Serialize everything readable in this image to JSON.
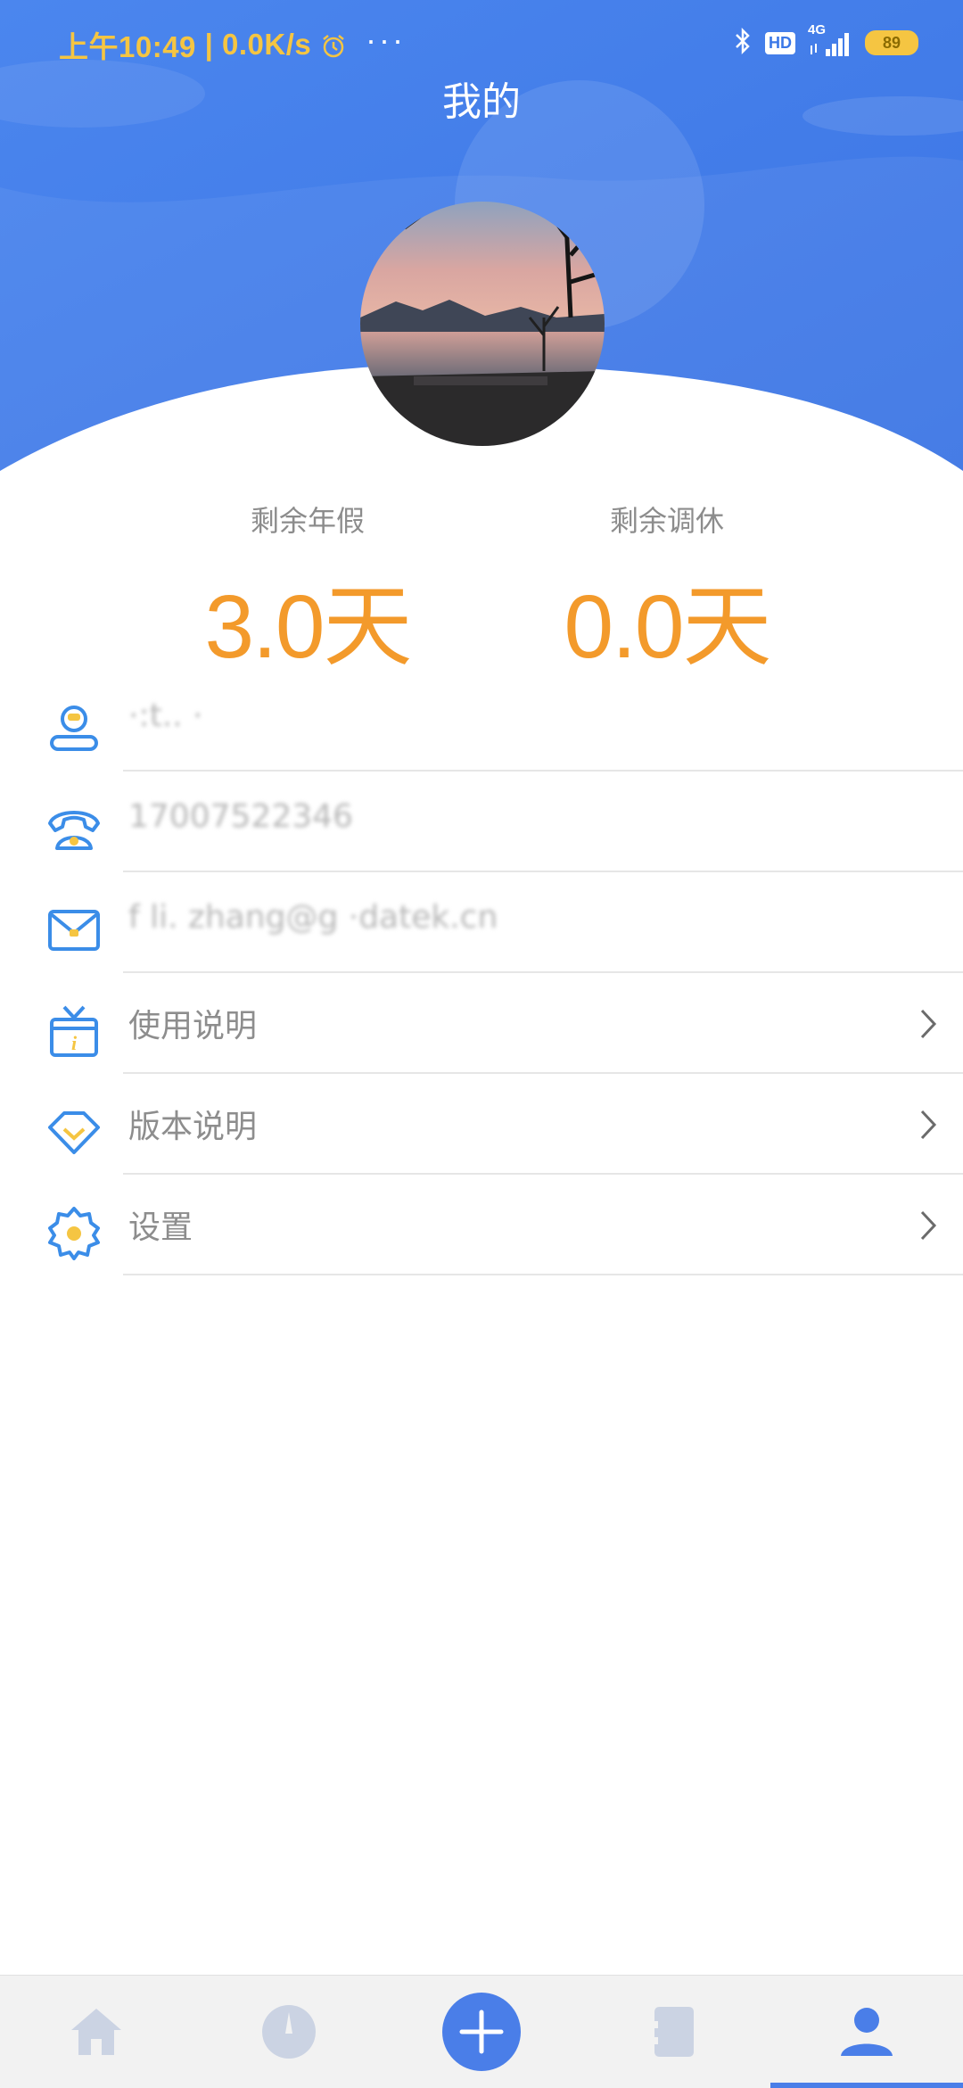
{
  "status_bar": {
    "time": "上午10:49",
    "speed": "0.0K/s",
    "more": "···",
    "hd_badge": "HD",
    "network": "4G",
    "battery": "89"
  },
  "header": {
    "title": "我的"
  },
  "stats": {
    "annual_leave_label": "剩余年假",
    "annual_leave_value": "3.0天",
    "comp_leave_label": "剩余调休",
    "comp_leave_value": "0.0天"
  },
  "menu": {
    "items": [
      {
        "icon": "user-icon",
        "label": "·:t.. ·"
      },
      {
        "icon": "phone-icon",
        "label": "17007522346"
      },
      {
        "icon": "mail-icon",
        "label": "f li. zhang@g ·datek.cn"
      },
      {
        "icon": "gift-info-icon",
        "label": "使用说明"
      },
      {
        "icon": "diamond-icon",
        "label": "版本说明"
      },
      {
        "icon": "gear-icon",
        "label": "设置"
      }
    ]
  },
  "tabbar": {
    "tabs": [
      "home-icon",
      "compass-icon",
      "add-icon",
      "card-icon",
      "profile-icon"
    ],
    "active": "profile-icon"
  },
  "colors": {
    "primary": "#4a7ee8",
    "accent": "#f39a2b",
    "status": "#f5c542"
  }
}
